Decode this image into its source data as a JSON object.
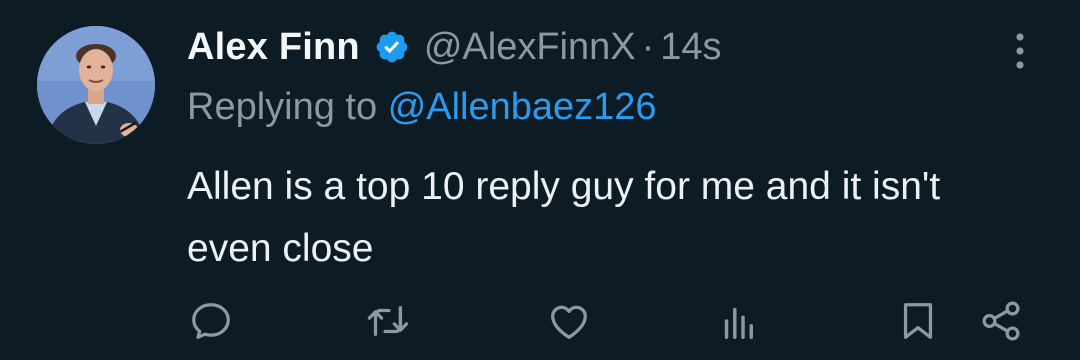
{
  "author": {
    "display_name": "Alex Finn",
    "handle": "@AlexFinnX",
    "separator": "·",
    "time": "14s",
    "verified": true
  },
  "reply": {
    "prefix": "Replying to",
    "target": "@Allenbaez126"
  },
  "tweet": {
    "text": "Allen is a top 10 reply guy for me and it isn't even close"
  },
  "icons": {
    "more": "more-vertical-icon",
    "verified": "verified-badge-icon",
    "reply": "reply-icon",
    "retweet": "retweet-icon",
    "like": "like-icon",
    "views": "views-icon",
    "bookmark": "bookmark-icon",
    "share": "share-icon"
  },
  "colors": {
    "background": "#0d1b25",
    "text": "#e7e9ea",
    "muted": "#8b98a5",
    "link": "#2b9bf0",
    "verified": "#1d9bf0"
  }
}
